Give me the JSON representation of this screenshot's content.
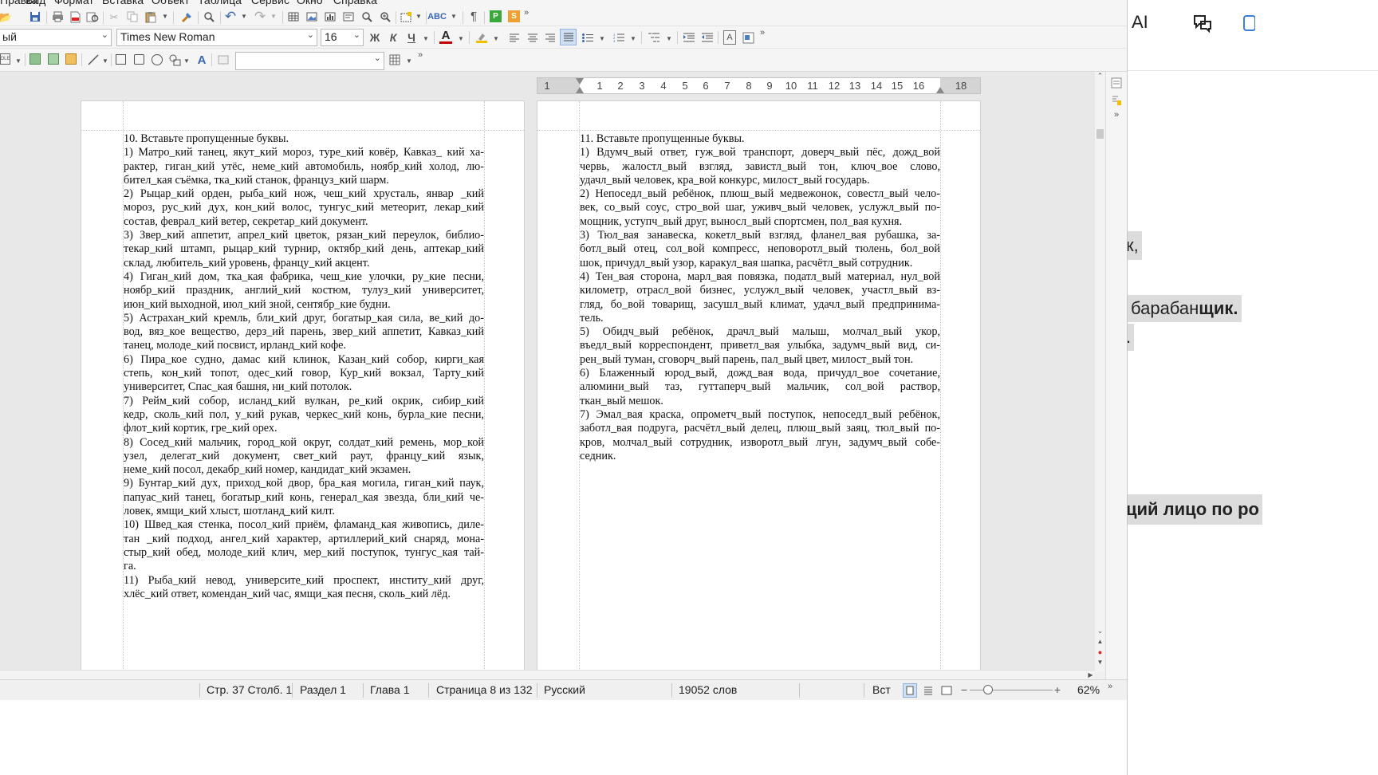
{
  "menubar": {
    "items": [
      "Правка",
      "Вид",
      "Формат",
      "Вставка",
      "Объект",
      "Таблица",
      "Сервис",
      "Окно",
      "Справка"
    ]
  },
  "toolbar": {
    "style_value": "ый",
    "font_name": "Times New Roman",
    "font_size": "16",
    "bold_label": "Ж",
    "italic_label": "К",
    "underline_label": "Ч",
    "font_color_label": "A",
    "textbox_label": "A",
    "overflow_label": "»"
  },
  "ruler": {
    "numbers": [
      "1",
      "1",
      "2",
      "3",
      "4",
      "5",
      "6",
      "7",
      "8",
      "9",
      "10",
      "11",
      "12",
      "13",
      "14",
      "15",
      "16",
      "18"
    ]
  },
  "page_left": {
    "heading": "10. Вставьте пропущенные буквы.",
    "lines": [
      "1) Матро_кий танец, якут_кий мороз, туре_кий ковёр, Кавказ_ кий ха-",
      "рактер, гиган_кий утёс, неме_кий автомобиль, ноябр_кий холод, лю-",
      "бител_кая съёмка, тка_кий станок, француз_кий шарм.",
      "2) Рыцар_кий орден, рыба_кий нож, чеш_кий хрусталь, январ _кий",
      "мороз, рус_кий дух, кон_кий волос, тунгус_кий метеорит, лекар_кий",
      "состав, феврал_кий ветер, секретар_кий документ.",
      "3) Звер_кий аппетит, апрел_кий цветок, рязан_кий переулок, библио-",
      "текар_кий штамп, рыцар_кий турнир, октябр_кий день, аптекар_кий",
      "склад, любитель_кий уровень, францу_кий акцент.",
      "4) Гиган_кий дом, тка_кая фабрика, чеш_кие улочки, ру_кие песни,",
      "ноябр_кий праздник, англий_кий костюм, тулуз_кий университет,",
      "июн_кий выходной, июл_кий зной, сентябр_кие будни.",
      "5) Астрахан_кий кремль, бли_кий друг, богатыр_кая сила, ве_кий до-",
      "вод, вяз_кое вещество, дерз_ий парень, звер_кий аппетит, Кавказ_кий",
      "танец, молоде_кий посвист, ирланд_кий кофе.",
      "6) Пира_кое судно, дамас кий клинок, Казан_кий собор, кирги_кая",
      "степь, кон_кий топот, одес_кий говор, Кур_кий вокзал, Тарту_кий",
      "университет, Спас_кая башня, ни_кий потолок.",
      "7) Рейм_кий собор, исланд_кий вулкан, ре_кий окрик, сибир_кий",
      "кедр, сколь_кий пол, у_кий рукав, черкес_кий конь, бурла_кие песни,",
      "флот_кий кортик, гре_кий орех.",
      "8) Сосед_кий мальчик, город_кой округ, солдат_кий ремень, мор_кой",
      "узел, делегат_кий документ, свет_кий раут, францу_кий язык,",
      "неме_кий посол, декабр_кий номер, кандидат_кий экзамен.",
      "9) Бунтар_кий дух, приход_кой двор, бра_кая могила, гиган_кий паук,",
      "папуас_кий танец, богатыр_кий конь, генерал_кая звезда, бли_кий че-",
      "ловек, ямщи_кий хлыст, шотланд_кий килт.",
      "10) Швед_кая стенка, посол_кий приём, фламанд_кая живопись, диле-",
      "тан _кий подход, ангел_кий характер, артиллерий_кий снаряд, мона-",
      "стыр_кий обед, молоде_кий клич, мер_кий поступок, тунгус_кая тай-",
      "га.",
      "11) Рыба_кий невод, университе_кий проспект, институ_кий друг,",
      "хлёс_кий ответ, комендан_кий час, ямщи_кая песня, сколь_кий лёд."
    ]
  },
  "page_right": {
    "heading": "11. Вставьте пропущенные буквы.",
    "lines": [
      "1) Вдумч_вый ответ, гуж_вой транспорт, доверч_вый пёс, дожд_вой",
      "червь, жалостл_вый взгляд, завистл_вый тон, ключ_вое слово,",
      "удачл_вый человек, кра_вой конкурс, милост_вый государь.",
      "2) Непоседл_вый ребёнок, плюш_вый медвежонок, совестл_вый чело-",
      "век, со_вый соус, стро_вой шаг, уживч_вый человек, услужл_вый по-",
      "мощник, уступч_вый друг, выносл_вый спортсмен, пол_вая кухня.",
      "3) Тюл_вая занавеска, кокетл_вый взгляд, фланел_вая рубашка, за-",
      "ботл_вый отец, сол_вой компресс, неповоротл_вый тюлень, бол_вой",
      "шок, причудл_вый узор, каракул_вая шапка, расчётл_вый сотрудник.",
      "4) Тен_вая сторона, марл_вая повязка, податл_вый материал, нул_вой",
      "километр, отрасл_вой бизнес, услужл_вый человек, участл_вый вз-",
      "гляд, бо_вой товарищ, засушл_вый климат, удачл_вый предпринима-",
      "тель.",
      "5) Обидч_вый ребёнок, драчл_вый малыш, молчал_вый укор,",
      "въедл_вый корреспондент, приветл_вая улыбка, задумч_вый вид, си-",
      "рен_вый туман, сговорч_вый парень, пал_вый цвет, милост_вый тон.",
      "6) Блаженный юрод_вый, дожд_вая вода, причудл_вое сочетание,",
      "алюмини_вый таз, гуттаперч_вый мальчик, сол_вой раствор,",
      "ткан_вый мешок.",
      "7) Эмал_вая краска, опрометч_вый поступок, непоседл_вый ребёнок,",
      "заботл_вая подруга, расчётл_вый делец, плюш_вый заяц, тюл_вый по-",
      "кров, молчал_вый сотрудник, изворотл_вый лгун, задумч_вый собе-",
      "седник."
    ]
  },
  "statusbar": {
    "position": "Стр. 37 Столб. 1",
    "section": "Раздел 1",
    "chapter": "Глава 1",
    "page": "Страница 8 из 132",
    "language": "Русский",
    "words": "19052 слов",
    "insert_mode": "Вст",
    "zoom": "62%"
  },
  "right_window": {
    "ai_label": "AI",
    "snippet_1": "к,",
    "snippet_2_plain": "барабан",
    "snippet_2_bold": "щик.",
    "snippet_3": ".",
    "snippet_4": "ций лицо по ро"
  },
  "colors": {
    "accent": "#4a7fc1",
    "font_color": "#c00000",
    "highlight": "#f0c000",
    "green_icon": "#3aa83a",
    "orange_icon": "#f0a030"
  }
}
